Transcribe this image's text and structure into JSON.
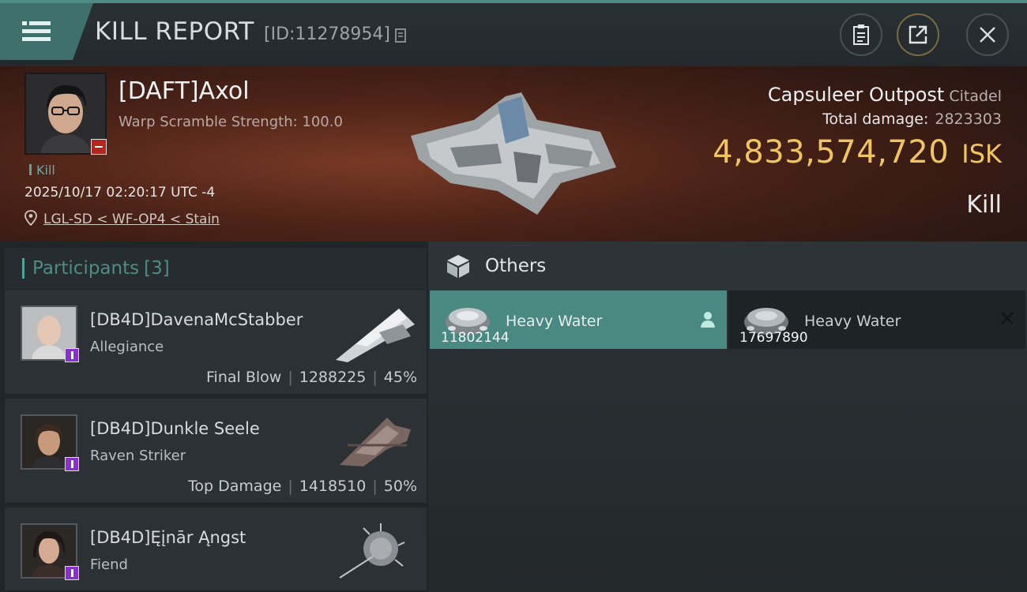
{
  "header": {
    "title": "KILL REPORT",
    "report_id": "[ID:11278954]"
  },
  "victim": {
    "name": "[DAFT]Axol",
    "warp_scramble": "Warp Scramble Strength: 100.0",
    "kill_tag": "Kill",
    "datetime": "2025/10/17 02:20:17 UTC -4",
    "location": "LGL-SD < WF-OP4 < Stain",
    "structure_name": "Capsuleer Outpost",
    "structure_type": "Citadel",
    "total_damage_label": "Total damage:",
    "total_damage": "2823303",
    "isk_value": "4,833,574,720",
    "isk_unit": "ISK",
    "result": "Kill"
  },
  "participants": {
    "label": "Participants",
    "count": "[3]",
    "list": [
      {
        "name": "[DB4D]DavenaMcStabber",
        "ship": "Allegiance",
        "role": "Final Blow",
        "damage": "1288225",
        "percent": "45%"
      },
      {
        "name": "[DB4D]Dunkle Seele",
        "ship": "Raven Striker",
        "role": "Top Damage",
        "damage": "1418510",
        "percent": "50%"
      },
      {
        "name": "[DB4D]Ęįnār Ąngst",
        "ship": "Fiend"
      }
    ]
  },
  "others": {
    "label": "Others",
    "items": [
      {
        "name": "Heavy Water",
        "quantity": "11802144"
      },
      {
        "name": "Heavy Water",
        "quantity": "17697890"
      }
    ]
  },
  "colors": {
    "accent": "#4f8c86",
    "isk": "#f0c560",
    "badge_victim": "#b3261e",
    "badge_participant": "#8a2fd0"
  },
  "icons": [
    "menu-icon",
    "copy-icon",
    "clipboard-icon",
    "share-icon",
    "close-icon",
    "location-pin-icon",
    "cube-icon",
    "heavy-water-icon",
    "person-icon",
    "x-icon"
  ]
}
